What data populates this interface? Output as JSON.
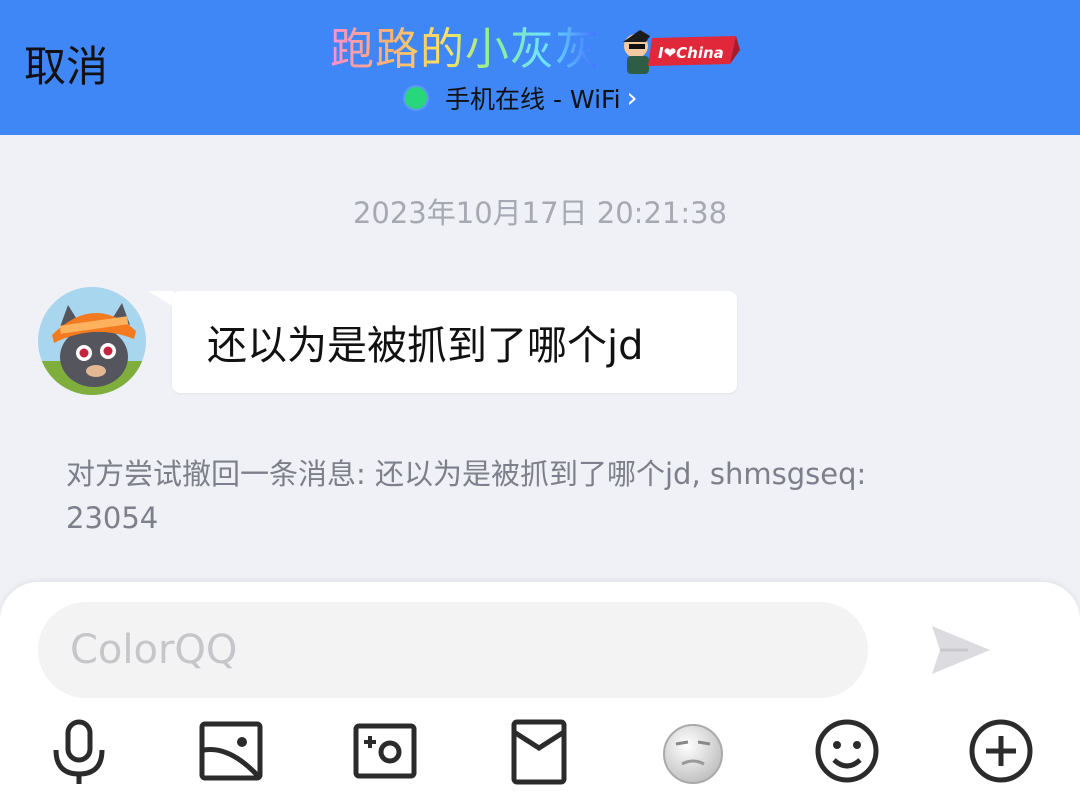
{
  "header": {
    "cancel_label": "取消",
    "contact_name": "跑路的小灰灰",
    "badge_text": "I❤China",
    "status_text": "手机在线 - WiFi",
    "status_chevron": "›",
    "status_color": "#28d67c",
    "background_color": "#3f86f6"
  },
  "chat": {
    "timestamp": "2023年10月17日 20:21:38",
    "messages": [
      {
        "sender": "contact",
        "text": "还以为是被抓到了哪个jd"
      }
    ],
    "system_note": "对方尝试撤回一条消息: 还以为是被抓到了哪个jd, shmsgseq: 23054"
  },
  "composer": {
    "placeholder": "ColorQQ",
    "send_icon": "send-arrow-icon",
    "toolbar": [
      {
        "icon": "microphone-icon"
      },
      {
        "icon": "image-icon"
      },
      {
        "icon": "camera-icon"
      },
      {
        "icon": "red-envelope-icon"
      },
      {
        "icon": "sticker-face-icon"
      },
      {
        "icon": "emoji-icon"
      },
      {
        "icon": "plus-circle-icon"
      }
    ]
  }
}
